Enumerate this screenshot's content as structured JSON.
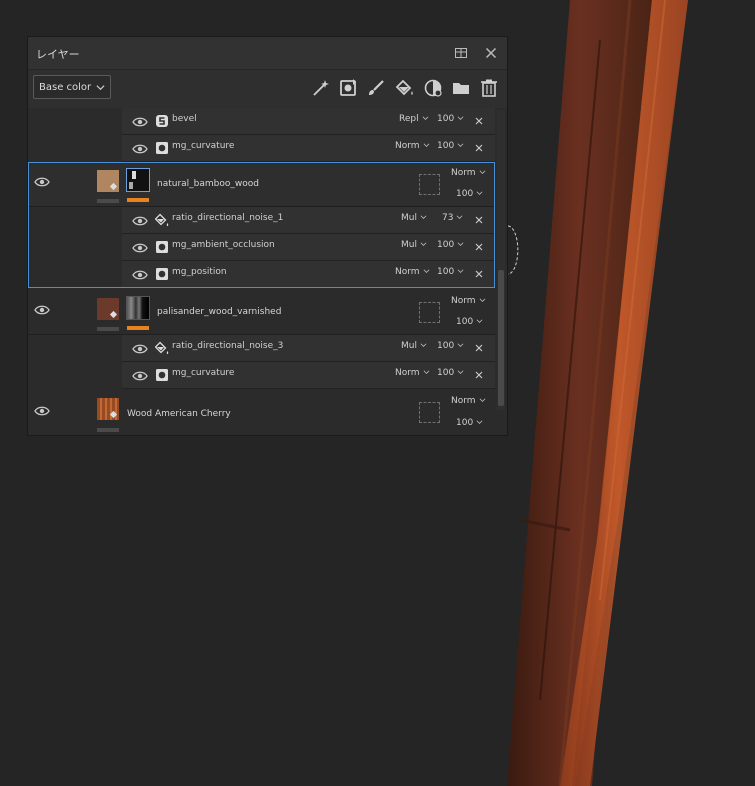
{
  "panel": {
    "title": "レイヤー",
    "channel": "Base color"
  },
  "toolbar": {
    "icons": [
      "magic-wand-icon",
      "smart-mask-icon",
      "brush-icon",
      "fill-bucket-icon",
      "smart-material-icon",
      "folder-icon",
      "trash-icon"
    ]
  },
  "layers": [
    {
      "name": "",
      "filters": [
        {
          "name": "bevel",
          "icon": "bevel-icon",
          "blend": "Repl",
          "opacity": "100"
        },
        {
          "name": "mg_curvature",
          "icon": "generator-icon",
          "blend": "Norm",
          "opacity": "100"
        }
      ]
    },
    {
      "name": "natural_bamboo_wood",
      "blend": "Norm",
      "opacity": "100",
      "selected": true,
      "thumb_color": "#b08660",
      "filters": [
        {
          "name": "ratio_directional_noise_1",
          "icon": "fill-icon",
          "blend": "Mul",
          "opacity": "73"
        },
        {
          "name": "mg_ambient_occlusion",
          "icon": "generator-icon",
          "blend": "Mul",
          "opacity": "100"
        },
        {
          "name": "mg_position",
          "icon": "generator-icon",
          "blend": "Norm",
          "opacity": "100"
        }
      ]
    },
    {
      "name": "palisander_wood_varnished",
      "blend": "Norm",
      "opacity": "100",
      "thumb_color": "#6b3a2a",
      "filters": [
        {
          "name": "ratio_directional_noise_3",
          "icon": "fill-icon",
          "blend": "Mul",
          "opacity": "100"
        },
        {
          "name": "mg_curvature",
          "icon": "generator-icon",
          "blend": "Norm",
          "opacity": "100"
        }
      ]
    },
    {
      "name": "Wood American Cherry",
      "blend": "Norm",
      "opacity": "100",
      "thumb_color": "#9a4a22"
    }
  ],
  "colors": {
    "accent": "#4a8fd6",
    "mask_bar": "#e8821e",
    "panel_bg": "#2b2b2b",
    "viewport_bg": "#252525"
  }
}
